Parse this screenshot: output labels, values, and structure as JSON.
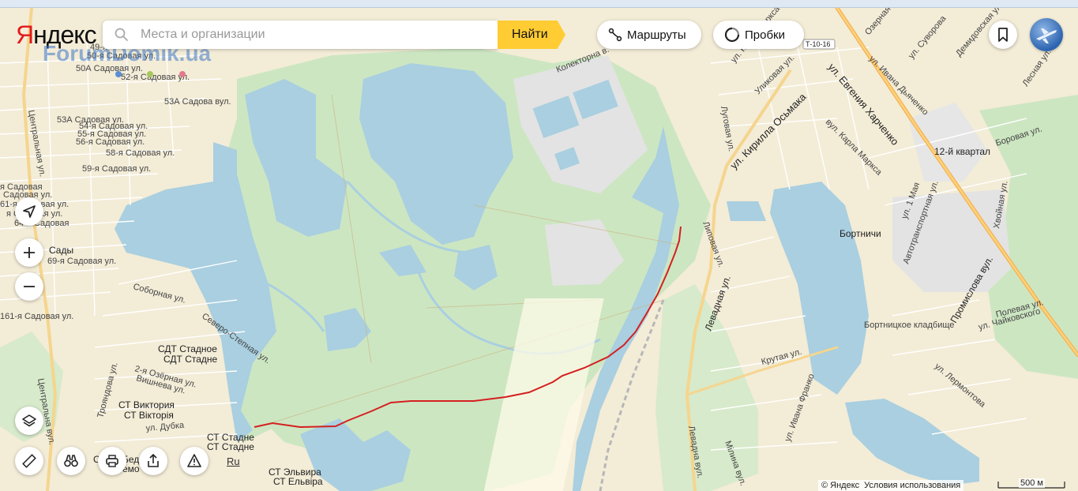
{
  "brand": {
    "logo_first": "Я",
    "logo_rest": "ндекс",
    "watermark": "ForumDomik.ua"
  },
  "search": {
    "placeholder": "Места и организации",
    "button_label": "Найти"
  },
  "toolbar": {
    "routes_label": "Маршруты",
    "traffic_label": "Пробки"
  },
  "road_shield": "Т-10-16",
  "footer": {
    "copyright": "© Яндекс",
    "terms": "Условия использования",
    "scale": "500 м",
    "lang": "Ru"
  },
  "colors": {
    "water": "#a9cfe0",
    "forest": "#cde6c2",
    "land": "#f3ecd7",
    "industrial": "#e1e1e1",
    "road_major": "#f5b14d",
    "route": "#d42020",
    "accent": "#ffcc33"
  },
  "icons": {
    "search": "search-icon",
    "routes": "routes-icon",
    "traffic": "traffic-icon",
    "bookmark": "bookmark-icon",
    "locate": "locate-icon",
    "zoom_in": "plus-icon",
    "zoom_out": "minus-icon",
    "layers": "layers-icon",
    "ruler": "ruler-icon",
    "panorama": "binoculars-icon",
    "print": "print-icon",
    "share": "share-icon",
    "report": "warning-icon"
  },
  "labels": {
    "l1": "49-я",
    "l2": "50-я Садовая ул.",
    "l3": "50А Садовая ул.",
    "l4": "52-я Садовая ул.",
    "l5": "53А Садова вул.",
    "l6": "53А Садовая ул.",
    "l7": "54-я Садовая ул.",
    "l8": "55-я Садовая ул.",
    "l9": "56-я Садовая ул.",
    "l10": "58-я Садовая ул.",
    "l11": "59-я Садовая ул.",
    "l12": "Центральная ул.",
    "l13": "я Садовая",
    "l14": "Садовая ул.",
    "l15": "61-я Садовая ул.",
    "l16": "я Садовая ул.",
    "l17": "64-я Садовая",
    "l18": "69-я Садовая ул.",
    "l19": "Сады",
    "l20": "161-я Садовая ул.",
    "l21": "Соборная ул.",
    "l22": "Северо-Степная ул.",
    "l23": "СДТ Стадное",
    "l24": "СДТ Стадне",
    "l25": "2-я Озёрная ул.",
    "l26": "Вишнева ул.",
    "l27": "Трояндова ул.",
    "l28": "СТ Виктория",
    "l29": "СТ Вікторія",
    "l30": "ул. Дубка",
    "l31": "Центральна вул.",
    "l32": "СТ Стадне",
    "l33": "СТ Стадне",
    "l34": "СТ Эльвира",
    "l35": "СТ Ельвіра",
    "l36": "Колекторна в.",
    "l37": "ул. Карла Маркса",
    "l38": "Уликовая ул.",
    "l39": "Луговая ул.",
    "l40": "ул. Кирилла Осьмака",
    "l41": "ул. Евгения Харченко",
    "l42": "ул. Ивана Дьяченко",
    "l43": "ул. Суворова",
    "l44": "Озерная ул.",
    "l45": "Демидовская ул.",
    "l46": "Лесная ул.",
    "l47": "вул. Карла Маркса",
    "l48": "12-й квартал",
    "l49": "Боровая ул.",
    "l50": "ул. 1 Мая",
    "l51": "Автотранспортная ул.",
    "l52": "Хвойная ул.",
    "l53": "Бортничи",
    "l54": "Липовая ул.",
    "l55": "Левадная ул.",
    "l56": "Промислова вул.",
    "l57": "Полевая ул.",
    "l58": "ул. Чайковского",
    "l59": "Бортницкое кладбище",
    "l60": "Крутая ул.",
    "l61": "ул. Лермонтова",
    "l62": "Левадна вул.",
    "l63": "Мілина вул.",
    "l64": "ул. Ивана Франко",
    "l65": "Бед",
    "l66": "емо",
    "l67": "С"
  }
}
